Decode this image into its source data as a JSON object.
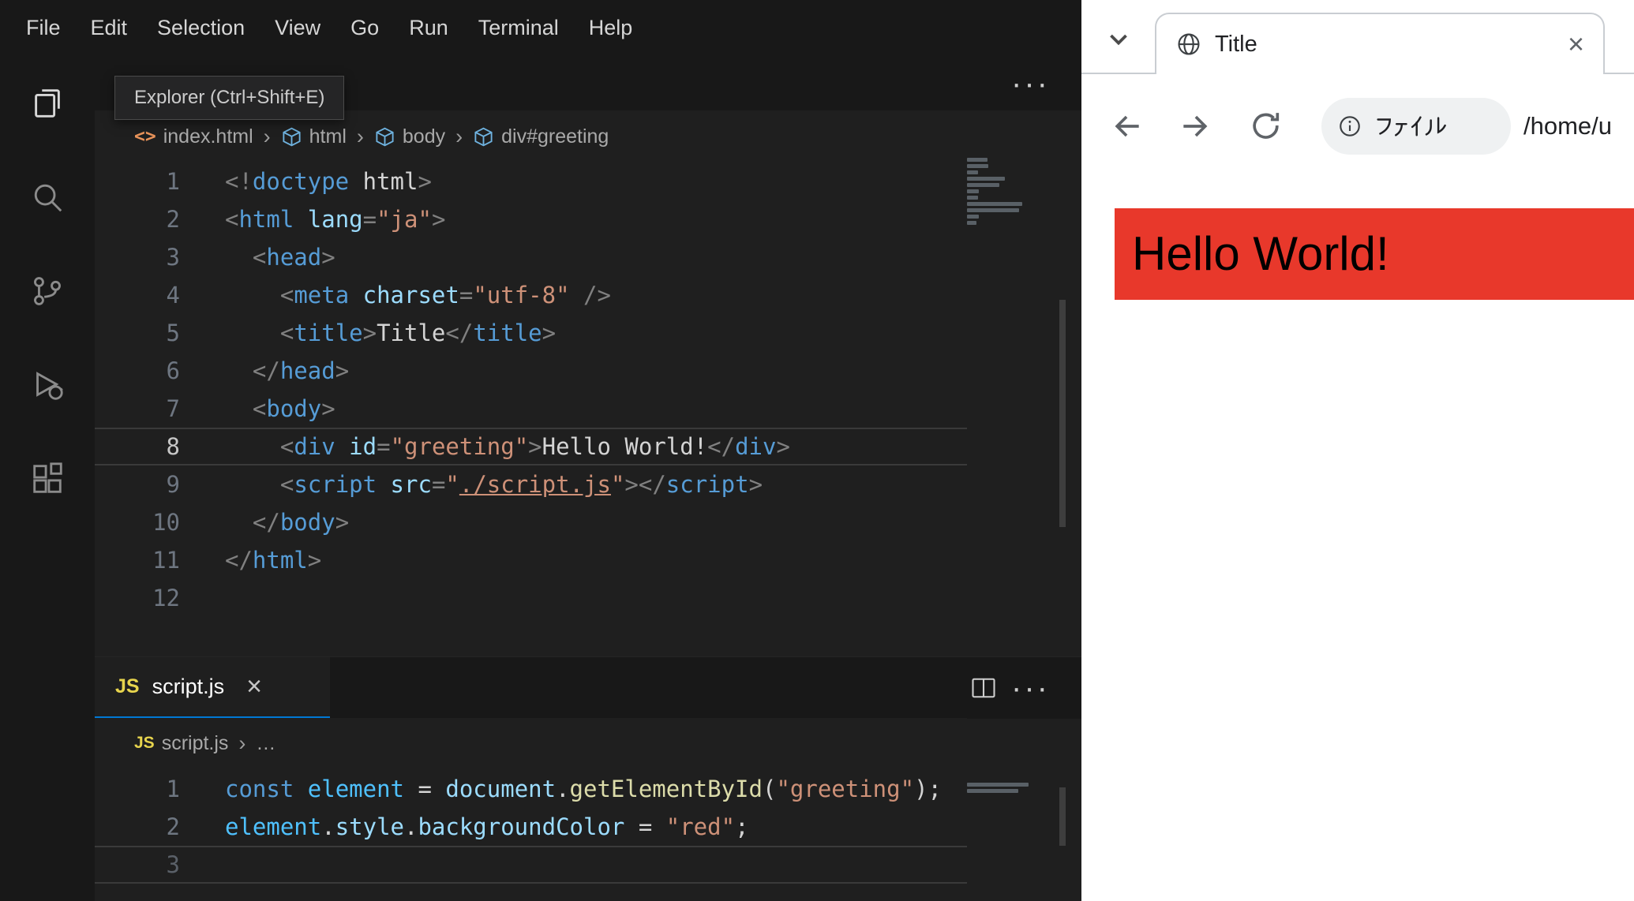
{
  "vscode": {
    "menu": {
      "items": [
        "File",
        "Edit",
        "Selection",
        "View",
        "Go",
        "Run",
        "Terminal",
        "Help"
      ]
    },
    "activity_bar": {
      "icons": [
        "explorer-icon",
        "search-icon",
        "source-control-icon",
        "run-debug-icon",
        "extensions-icon"
      ]
    },
    "tooltip": {
      "text": "Explorer (Ctrl+Shift+E)"
    },
    "colors": {
      "accent": "#0078d4"
    },
    "editor_top": {
      "more_label": "···",
      "breadcrumb": [
        {
          "icon": "html-file-icon",
          "label": "index.html"
        },
        {
          "icon": "symbol-cube-icon",
          "label": "html"
        },
        {
          "icon": "symbol-cube-icon",
          "label": "body"
        },
        {
          "icon": "symbol-cube-icon",
          "label": "div#greeting"
        }
      ],
      "active_line": 8,
      "lines": [
        {
          "num": 1,
          "tokens": [
            [
              "pt",
              "<!"
            ],
            [
              "tag",
              "doctype"
            ],
            [
              "txt",
              " html"
            ],
            [
              "pt",
              ">"
            ]
          ]
        },
        {
          "num": 2,
          "tokens": [
            [
              "pt",
              "<"
            ],
            [
              "tag",
              "html"
            ],
            [
              "txt",
              " "
            ],
            [
              "attr",
              "lang"
            ],
            [
              "pt",
              "="
            ],
            [
              "str",
              "\"ja\""
            ],
            [
              "pt",
              ">"
            ]
          ]
        },
        {
          "num": 3,
          "tokens": [
            [
              "txt",
              "  "
            ],
            [
              "pt",
              "<"
            ],
            [
              "tag",
              "head"
            ],
            [
              "pt",
              ">"
            ]
          ]
        },
        {
          "num": 4,
          "tokens": [
            [
              "txt",
              "    "
            ],
            [
              "pt",
              "<"
            ],
            [
              "tag",
              "meta"
            ],
            [
              "txt",
              " "
            ],
            [
              "attr",
              "charset"
            ],
            [
              "pt",
              "="
            ],
            [
              "str",
              "\"utf-8\""
            ],
            [
              "txt",
              " "
            ],
            [
              "pt",
              "/>"
            ]
          ]
        },
        {
          "num": 5,
          "tokens": [
            [
              "txt",
              "    "
            ],
            [
              "pt",
              "<"
            ],
            [
              "tag",
              "title"
            ],
            [
              "pt",
              ">"
            ],
            [
              "txt",
              "Title"
            ],
            [
              "pt",
              "</"
            ],
            [
              "tag",
              "title"
            ],
            [
              "pt",
              ">"
            ]
          ]
        },
        {
          "num": 6,
          "tokens": [
            [
              "txt",
              "  "
            ],
            [
              "pt",
              "</"
            ],
            [
              "tag",
              "head"
            ],
            [
              "pt",
              ">"
            ]
          ]
        },
        {
          "num": 7,
          "tokens": [
            [
              "txt",
              "  "
            ],
            [
              "pt",
              "<"
            ],
            [
              "tag",
              "body"
            ],
            [
              "pt",
              ">"
            ]
          ]
        },
        {
          "num": 8,
          "tokens": [
            [
              "txt",
              "    "
            ],
            [
              "pt",
              "<"
            ],
            [
              "tag",
              "div"
            ],
            [
              "txt",
              " "
            ],
            [
              "attr",
              "id"
            ],
            [
              "pt",
              "="
            ],
            [
              "str",
              "\"greeting\""
            ],
            [
              "pt",
              ">"
            ],
            [
              "txt",
              "Hello World!"
            ],
            [
              "pt",
              "</"
            ],
            [
              "tag",
              "div"
            ],
            [
              "pt",
              ">"
            ]
          ]
        },
        {
          "num": 9,
          "tokens": [
            [
              "txt",
              "    "
            ],
            [
              "pt",
              "<"
            ],
            [
              "tag",
              "script"
            ],
            [
              "txt",
              " "
            ],
            [
              "attr",
              "src"
            ],
            [
              "pt",
              "="
            ],
            [
              "str",
              "\""
            ],
            [
              "link",
              "./script.js"
            ],
            [
              "str",
              "\""
            ],
            [
              "pt",
              ">"
            ],
            [
              "pt",
              "</"
            ],
            [
              "tag",
              "script"
            ],
            [
              "pt",
              ">"
            ]
          ]
        },
        {
          "num": 10,
          "tokens": [
            [
              "txt",
              "  "
            ],
            [
              "pt",
              "</"
            ],
            [
              "tag",
              "body"
            ],
            [
              "pt",
              ">"
            ]
          ]
        },
        {
          "num": 11,
          "tokens": [
            [
              "pt",
              "</"
            ],
            [
              "tag",
              "html"
            ],
            [
              "pt",
              ">"
            ]
          ]
        },
        {
          "num": 12,
          "tokens": []
        }
      ]
    },
    "editor_bottom": {
      "more_label": "···",
      "tab": {
        "icon": "js-icon",
        "label": "script.js",
        "close": "×"
      },
      "breadcrumb": [
        {
          "icon": "js-icon",
          "label": "script.js"
        },
        {
          "icon": null,
          "label": "…"
        }
      ],
      "active_line": 3,
      "lines": [
        {
          "num": 1,
          "tokens": [
            [
              "kw",
              "const"
            ],
            [
              "txt",
              " "
            ],
            [
              "cvar",
              "element"
            ],
            [
              "txt",
              " = "
            ],
            [
              "var",
              "document"
            ],
            [
              "txt",
              "."
            ],
            [
              "fn",
              "getElementById"
            ],
            [
              "txt",
              "("
            ],
            [
              "str",
              "\"greeting\""
            ],
            [
              "txt",
              ");"
            ]
          ]
        },
        {
          "num": 2,
          "tokens": [
            [
              "cvar",
              "element"
            ],
            [
              "txt",
              "."
            ],
            [
              "var",
              "style"
            ],
            [
              "txt",
              "."
            ],
            [
              "var",
              "backgroundColor"
            ],
            [
              "txt",
              " = "
            ],
            [
              "str",
              "\"red\""
            ],
            [
              "txt",
              ";"
            ]
          ]
        },
        {
          "num": 3,
          "tokens": []
        }
      ]
    }
  },
  "browser": {
    "tab": {
      "title": "Title",
      "close": "×"
    },
    "toolbar": {
      "origin_chip": "ファイル",
      "address": "/home/u"
    },
    "page": {
      "heading": "Hello World!",
      "heading_bg": "#e8382b"
    }
  }
}
